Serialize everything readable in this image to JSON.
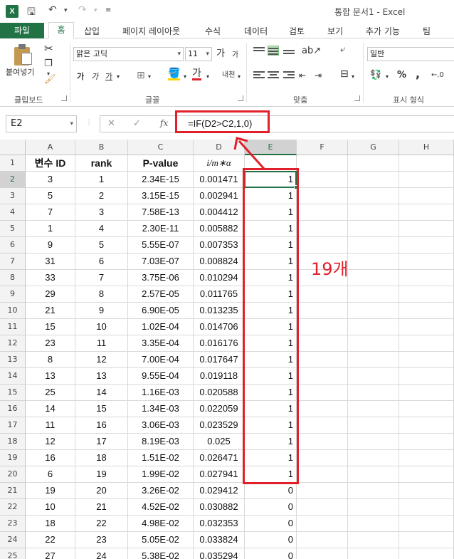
{
  "app": {
    "title": "통합 문서1 - Excel",
    "logo": "X",
    "qat": {
      "save_icon": "save-icon",
      "undo_icon": "undo-icon",
      "redo_icon": "redo-icon",
      "customize_icon": "customize-icon"
    }
  },
  "ribbon_tabs": [
    "파일",
    "홈",
    "삽입",
    "페이지 레이아웃",
    "수식",
    "데이터",
    "검토",
    "보기",
    "추가 기능",
    "팀"
  ],
  "ribbon": {
    "paste_label": "붙여넣기",
    "font_name": "맑은 고딕",
    "font_size": "11",
    "grow_font": "가",
    "shrink_font": "가",
    "bold": "가",
    "italic": "가",
    "underline": "가",
    "font_color_glyph": "가",
    "phonetic": "내천",
    "number_format": "일반",
    "percent": "%",
    "comma": ",",
    "groups": {
      "clipboard": "클립보드",
      "font": "글꼴",
      "alignment": "맞춤",
      "number": "표시 형식"
    }
  },
  "formula_bar": {
    "name_box": "E2",
    "fx": "fx",
    "formula": "=IF(D2>C2,1,0)"
  },
  "sheet": {
    "columns": [
      "A",
      "B",
      "C",
      "D",
      "E",
      "F",
      "G",
      "H"
    ],
    "selected_column": "E",
    "selected_row": "2",
    "row_numbers": [
      "1",
      "2",
      "3",
      "4",
      "5",
      "6",
      "7",
      "8",
      "9",
      "10",
      "11",
      "12",
      "13",
      "14",
      "15",
      "16",
      "17",
      "18",
      "19",
      "20",
      "21",
      "22",
      "23",
      "24",
      "25"
    ],
    "header_row": [
      "변수 ID",
      "rank",
      "P-value",
      "i/m∗α",
      ""
    ],
    "rows": [
      [
        "3",
        "1",
        "2.34E-15",
        "0.001471",
        "1"
      ],
      [
        "5",
        "2",
        "3.15E-15",
        "0.002941",
        "1"
      ],
      [
        "7",
        "3",
        "7.58E-13",
        "0.004412",
        "1"
      ],
      [
        "1",
        "4",
        "2.30E-11",
        "0.005882",
        "1"
      ],
      [
        "9",
        "5",
        "5.55E-07",
        "0.007353",
        "1"
      ],
      [
        "31",
        "6",
        "7.03E-07",
        "0.008824",
        "1"
      ],
      [
        "33",
        "7",
        "3.75E-06",
        "0.010294",
        "1"
      ],
      [
        "29",
        "8",
        "2.57E-05",
        "0.011765",
        "1"
      ],
      [
        "21",
        "9",
        "6.90E-05",
        "0.013235",
        "1"
      ],
      [
        "15",
        "10",
        "1.02E-04",
        "0.014706",
        "1"
      ],
      [
        "23",
        "11",
        "3.35E-04",
        "0.016176",
        "1"
      ],
      [
        "8",
        "12",
        "7.00E-04",
        "0.017647",
        "1"
      ],
      [
        "13",
        "13",
        "9.55E-04",
        "0.019118",
        "1"
      ],
      [
        "25",
        "14",
        "1.16E-03",
        "0.020588",
        "1"
      ],
      [
        "14",
        "15",
        "1.34E-03",
        "0.022059",
        "1"
      ],
      [
        "11",
        "16",
        "3.06E-03",
        "0.023529",
        "1"
      ],
      [
        "12",
        "17",
        "8.19E-03",
        "0.025",
        "1"
      ],
      [
        "16",
        "18",
        "1.51E-02",
        "0.026471",
        "1"
      ],
      [
        "6",
        "19",
        "1.99E-02",
        "0.027941",
        "1"
      ],
      [
        "19",
        "20",
        "3.26E-02",
        "0.029412",
        "0"
      ],
      [
        "10",
        "21",
        "4.52E-02",
        "0.030882",
        "0"
      ],
      [
        "18",
        "22",
        "4.98E-02",
        "0.032353",
        "0"
      ],
      [
        "22",
        "23",
        "5.05E-02",
        "0.033824",
        "0"
      ],
      [
        "27",
        "24",
        "5.38E-02",
        "0.035294",
        "0"
      ]
    ]
  },
  "annotation": {
    "count_label": "19개",
    "color": "#e0202a"
  },
  "colors": {
    "excel_green": "#217346",
    "annotation_red": "#e0202a"
  }
}
